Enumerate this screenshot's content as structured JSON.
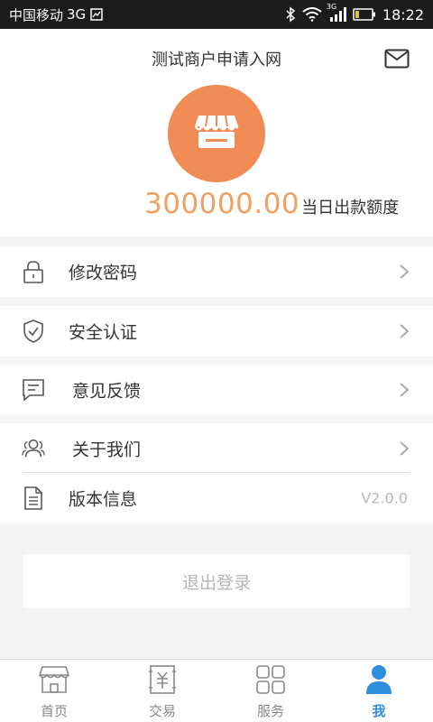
{
  "status_bar": {
    "carrier": "中国移动",
    "network": "3G",
    "signal_tag": "3G",
    "time": "18:22",
    "icons": [
      "sim-icon",
      "bluetooth-icon",
      "wifi-icon",
      "signal-icon",
      "battery-icon"
    ]
  },
  "profile": {
    "merchant_name": "测试商户申请入网",
    "amount": "300000.00",
    "amount_label": "当日出款额度",
    "avatar_icon": "shop-icon",
    "mail_icon": "mail-icon"
  },
  "menu": {
    "change_password": "修改密码",
    "security_auth": "安全认证",
    "feedback": "意见反馈",
    "about_us": "关于我们",
    "version_info": "版本信息",
    "version_value": "V2.0.0"
  },
  "logout_label": "退出登录",
  "tabs": [
    {
      "label": "首页",
      "icon": "home-shop-icon"
    },
    {
      "label": "交易",
      "icon": "transaction-icon"
    },
    {
      "label": "服务",
      "icon": "services-grid-icon"
    },
    {
      "label": "我",
      "icon": "user-icon"
    }
  ],
  "colors": {
    "accent_orange": "#f08b55",
    "amount_orange": "#f0a060",
    "active_blue": "#2d8ee0"
  }
}
